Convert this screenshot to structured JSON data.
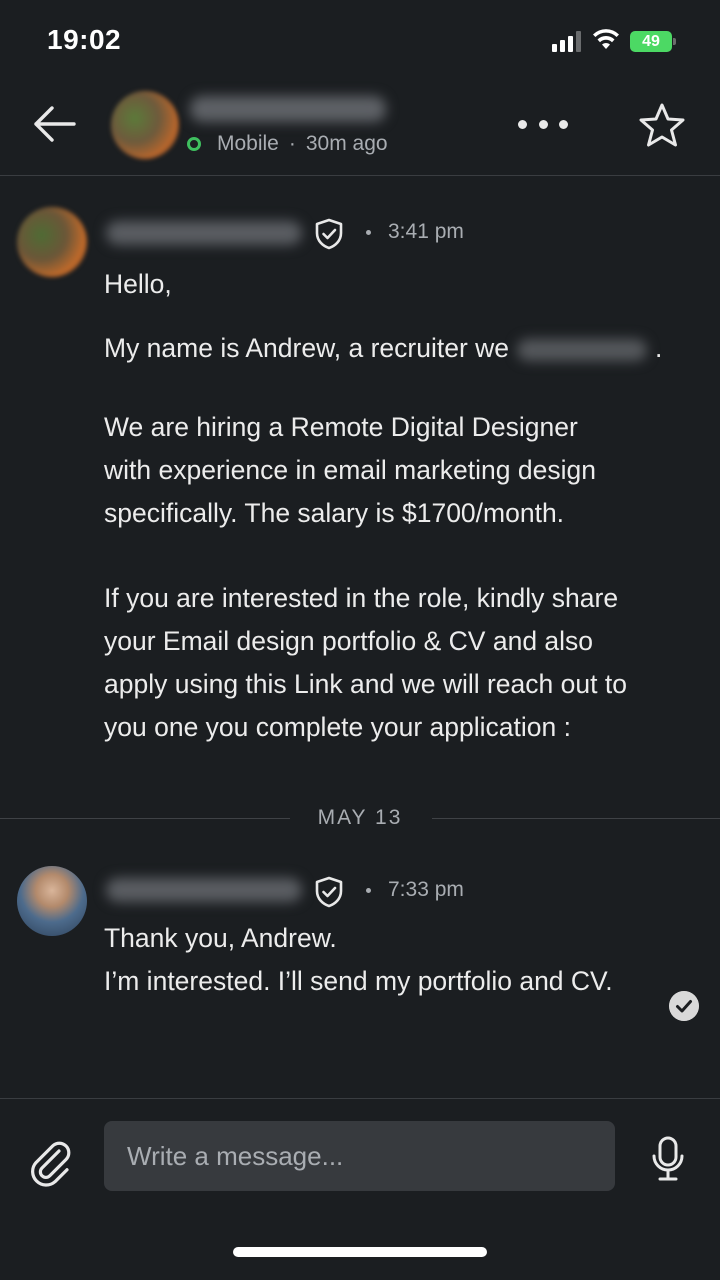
{
  "status_bar": {
    "time": "19:02",
    "battery": "49"
  },
  "header": {
    "presence": "Mobile",
    "last_seen": "30m ago"
  },
  "messages": [
    {
      "time": "3:41 pm",
      "lines": [
        "Hello,",
        "My name is Andrew, a recruiter we",
        ".",
        "We are hiring a Remote Digital Designer",
        "with experience in email marketing design",
        "specifically. The salary is $1700/month.",
        "If you are interested in the role, kindly share",
        "your Email design portfolio & CV and also",
        "apply using this Link and we will reach out to",
        "you one you complete your application :"
      ]
    },
    {
      "time": "7:33 pm",
      "lines": [
        "Thank you, Andrew.",
        "I’m interested. I’ll send my portfolio and CV."
      ]
    }
  ],
  "date_divider": "MAY 13",
  "composer": {
    "placeholder": "Write a message..."
  },
  "icons": {
    "back": "back-arrow-icon",
    "more": "more-dots-icon",
    "star": "star-icon",
    "verified": "shield-check-icon",
    "attach": "paperclip-icon",
    "mic": "microphone-icon",
    "read": "check-circle-icon"
  },
  "colors": {
    "background": "#1b1e21",
    "presence_online": "#3fbf5f",
    "battery": "#4cd964",
    "input_bg": "#373a3e"
  }
}
